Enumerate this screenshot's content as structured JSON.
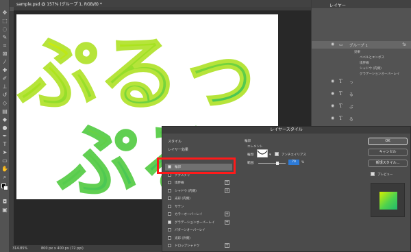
{
  "document": {
    "tab_title": "sample.psd @ 157% (グループ 1, RGB/8) *",
    "zoom": "314.85%",
    "doc_info": "800 px x 400 px (72 ppi)",
    "art_text_1": "ぷるっ",
    "art_text_2": "ぷる"
  },
  "layers_panel": {
    "title": "レイヤー",
    "group_name": "グループ 1",
    "effects_label": "効果",
    "effects": [
      "ベベルとエンボス",
      "境界線",
      "シャドウ (内側)",
      "グラデーションオーバーレイ"
    ],
    "text_layers": [
      "っ",
      "る",
      "ぷ",
      "る",
      "ぷ"
    ]
  },
  "dialog": {
    "title": "レイヤースタイル",
    "style_header": "スタイル",
    "layer_effects_label": "レイヤー効果",
    "items": [
      {
        "label": "輪郭",
        "checked": true,
        "plus": false,
        "selected": true
      },
      {
        "label": "テクスチャ",
        "checked": false,
        "plus": false,
        "selected": false
      },
      {
        "label": "境界線",
        "checked": false,
        "plus": true,
        "selected": false
      },
      {
        "label": "シャドウ (内側)",
        "checked": false,
        "plus": true,
        "selected": false
      },
      {
        "label": "光彩 (内側)",
        "checked": false,
        "plus": false,
        "selected": false
      },
      {
        "label": "サテン",
        "checked": false,
        "plus": false,
        "selected": false
      },
      {
        "label": "カラーオーバーレイ",
        "checked": false,
        "plus": true,
        "selected": false
      },
      {
        "label": "グラデーションオーバーレイ",
        "checked": true,
        "plus": true,
        "selected": false
      },
      {
        "label": "パターンオーバーレイ",
        "checked": false,
        "plus": false,
        "selected": false
      },
      {
        "label": "光彩 (外側)",
        "checked": false,
        "plus": false,
        "selected": false
      },
      {
        "label": "ドロップシャドウ",
        "checked": false,
        "plus": true,
        "selected": false
      }
    ],
    "options_title": "輪郭",
    "options_subtitle": "エレメント",
    "contour_label": "輪郭:",
    "antialias_label": "アンチエイリアス",
    "range_label": "範囲:",
    "range_value": "70",
    "range_unit": "%",
    "range_level": 0.7,
    "buttons": {
      "ok": "OK",
      "cancel": "キャンセル",
      "new_style": "新規スタイル...",
      "preview": "プレビュー"
    },
    "preview_checked": true
  },
  "colors": {
    "accent_highlight": "#ff1a1a",
    "art_yellow": "#d4f000",
    "art_green": "#21b96c"
  }
}
